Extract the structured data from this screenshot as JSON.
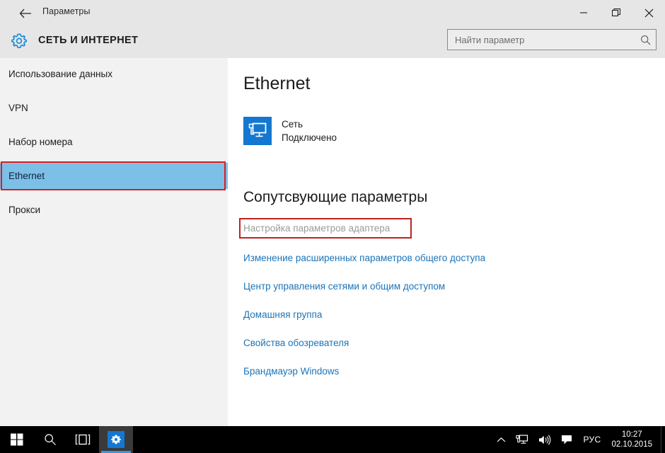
{
  "window": {
    "title": "Параметры",
    "back_icon": "back-arrow-icon",
    "minimize_label": "─",
    "restore_label": "restore-icon",
    "close_label": "✕"
  },
  "header": {
    "gear_icon": "gear-icon",
    "category": "СЕТЬ И ИНТЕРНЕТ",
    "search": {
      "placeholder": "Найти параметр",
      "value": "",
      "icon": "search-icon"
    }
  },
  "sidebar": {
    "items": [
      {
        "label": "Использование данных",
        "selected": false
      },
      {
        "label": "VPN",
        "selected": false
      },
      {
        "label": "Набор номера",
        "selected": false
      },
      {
        "label": "Ethernet",
        "selected": true
      },
      {
        "label": "Прокси",
        "selected": false
      }
    ]
  },
  "main": {
    "page_title": "Ethernet",
    "network": {
      "icon": "ethernet-monitor-icon",
      "name": "Сеть",
      "status": "Подключено"
    },
    "section_title": "Сопутсвующие параметры",
    "links": [
      {
        "label": "Настройка параметров адаптера",
        "muted": true
      },
      {
        "label": "Изменение расширенных параметров общего доступа",
        "muted": false
      },
      {
        "label": "Центр управления сетями и общим доступом",
        "muted": false
      },
      {
        "label": "Домашняя группа",
        "muted": false
      },
      {
        "label": "Свойства обозревателя",
        "muted": false
      },
      {
        "label": "Брандмауэр Windows",
        "muted": false
      }
    ]
  },
  "taskbar": {
    "start_icon": "windows-start-icon",
    "search_icon": "taskbar-search-icon",
    "taskview_icon": "task-view-icon",
    "settings_icon": "settings-gear-icon",
    "tray": {
      "chevron_icon": "show-hidden-icons-chevron",
      "network_icon": "network-icon",
      "volume_icon": "volume-icon",
      "action_center_icon": "action-center-icon",
      "language": "РУС",
      "time": "10:27",
      "date": "02.10.2015"
    }
  },
  "colors": {
    "accent": "#1477d1",
    "selection": "#7cc0e8",
    "link": "#1b74b8",
    "annotation": "#e21b1b",
    "header_bg": "#e6e6e6",
    "sidebar_bg": "#f2f2f2"
  }
}
